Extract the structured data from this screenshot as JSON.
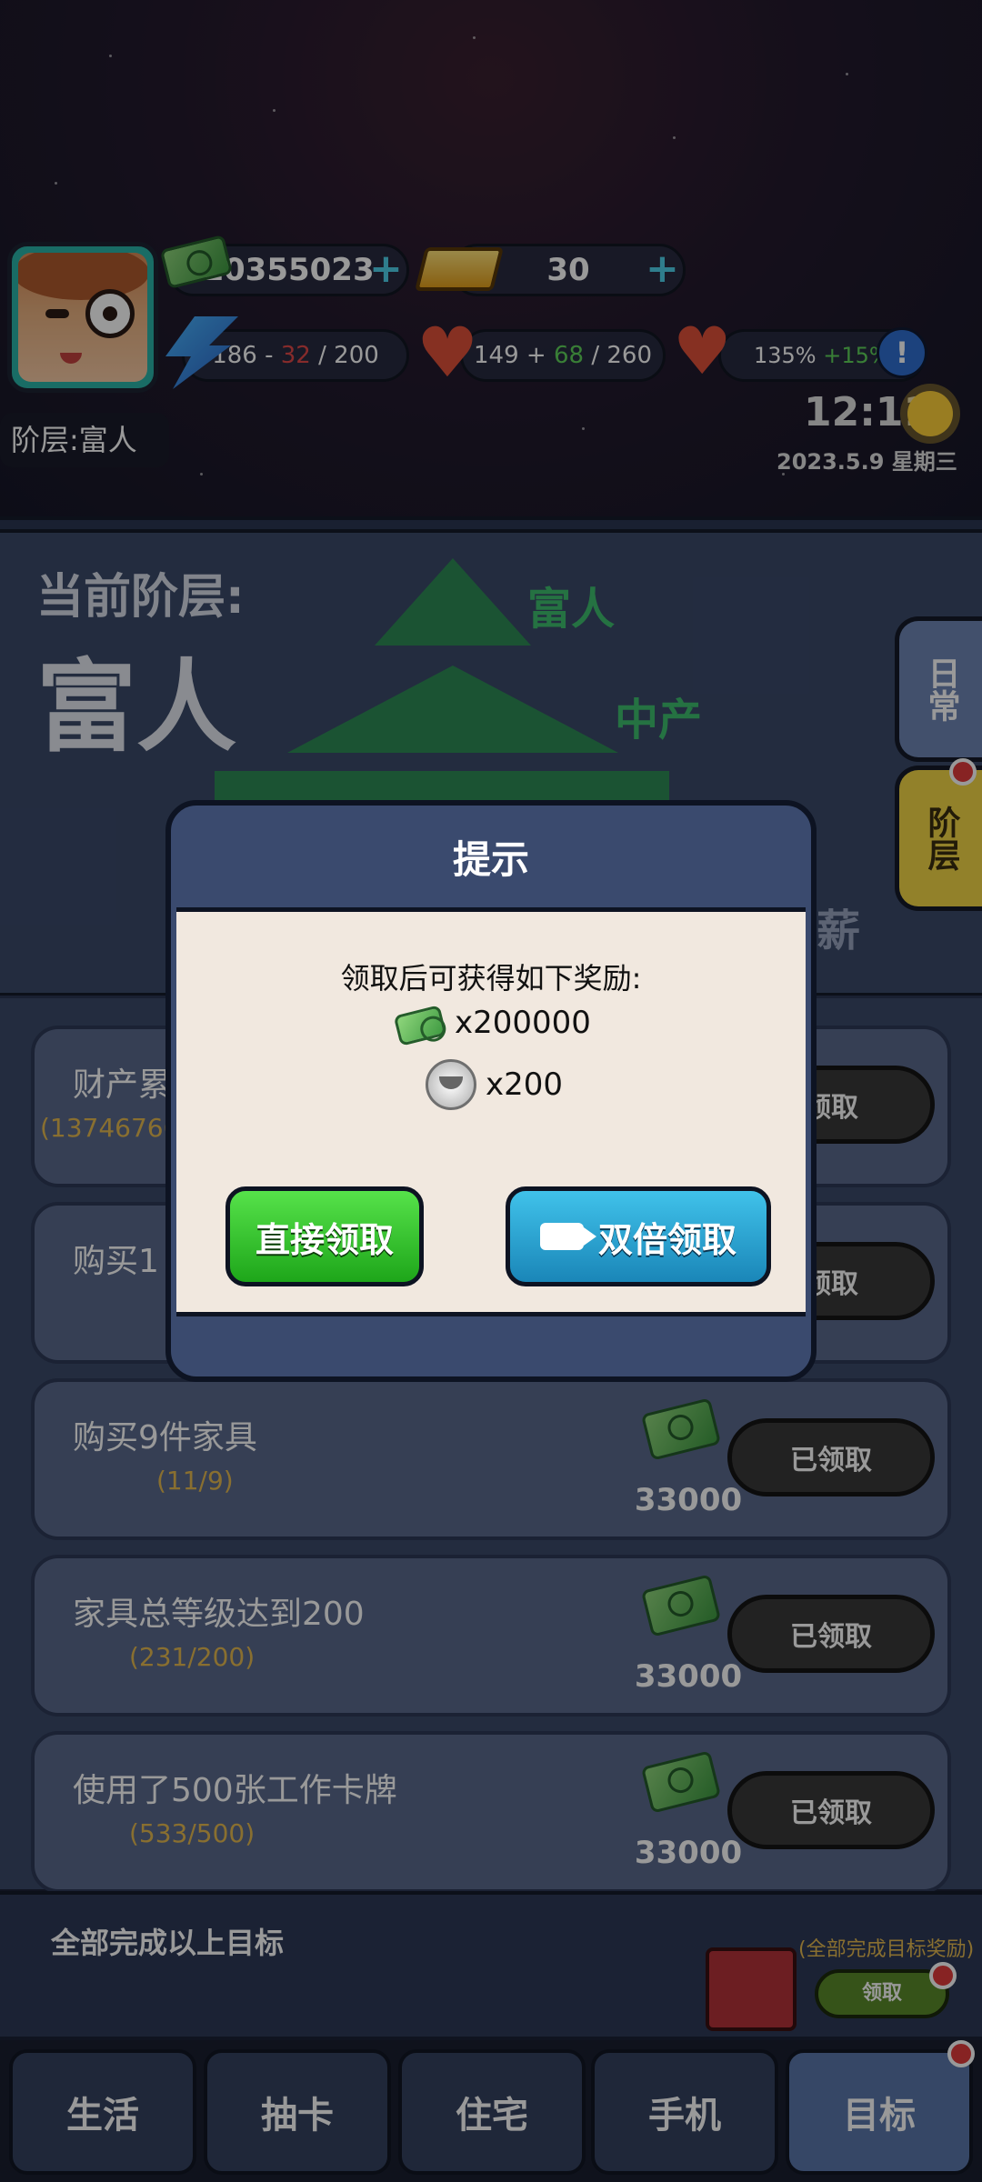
{
  "header": {
    "cash": "10355023",
    "gold": "30",
    "energy": {
      "current": "186",
      "minus": "32",
      "max": "200"
    },
    "health": {
      "current": "149",
      "plus": "68",
      "max": "260"
    },
    "mood": {
      "value": "135%",
      "bonus": "+15%"
    },
    "info_icon": "!",
    "rank_tag": "阶层:富人",
    "time": "12:11",
    "date": "2023.5.9  星期三"
  },
  "rank_panel": {
    "label": "当前阶层:",
    "current": "富人",
    "tiers": [
      "富人",
      "中产",
      "薪"
    ]
  },
  "side_tabs": [
    "日常",
    "阶层"
  ],
  "tasks": [
    {
      "title": "财产累",
      "progress": "(13746766",
      "reward": "",
      "button": "领取"
    },
    {
      "title": "购买1",
      "progress": "",
      "reward": "",
      "button": "领取"
    },
    {
      "title": "购买9件家具",
      "progress": "(11/9)",
      "reward": "33000",
      "button": "已领取"
    },
    {
      "title": "家具总等级达到200",
      "progress": "(231/200)",
      "reward": "33000",
      "button": "已领取"
    },
    {
      "title": "使用了500张工作卡牌",
      "progress": "(533/500)",
      "reward": "33000",
      "button": "已领取"
    }
  ],
  "all_complete": {
    "title": "全部完成以上目标",
    "reward_label": "(全部完成目标奖励)",
    "button": "领取"
  },
  "dialog": {
    "title": "提示",
    "message": "领取后可获得如下奖励:",
    "reward_cash": "x200000",
    "reward_coin": "x200",
    "btn_direct": "直接领取",
    "btn_double": "双倍领取"
  },
  "nav": [
    "生活",
    "抽卡",
    "住宅",
    "手机",
    "目标"
  ]
}
